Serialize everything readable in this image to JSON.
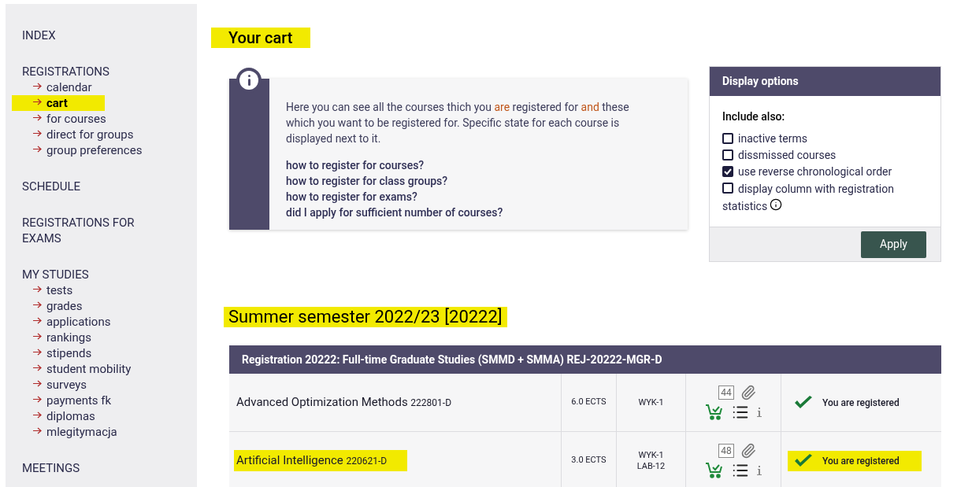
{
  "sidebar": {
    "sections": [
      {
        "title": "INDEX"
      },
      {
        "title": "REGISTRATIONS",
        "items": [
          {
            "label": "calendar",
            "selected": false
          },
          {
            "label": "cart",
            "selected": true
          },
          {
            "label": "for courses",
            "selected": false
          },
          {
            "label": "direct for groups",
            "selected": false
          },
          {
            "label": "group preferences",
            "selected": false
          }
        ]
      },
      {
        "title": "SCHEDULE"
      },
      {
        "title": "REGISTRATIONS FOR EXAMS"
      },
      {
        "title": "MY STUDIES",
        "items": [
          {
            "label": "tests",
            "selected": false
          },
          {
            "label": "grades",
            "selected": false
          },
          {
            "label": "applications",
            "selected": false
          },
          {
            "label": "rankings",
            "selected": false
          },
          {
            "label": "stipends",
            "selected": false
          },
          {
            "label": "student mobility",
            "selected": false
          },
          {
            "label": "surveys",
            "selected": false
          },
          {
            "label": "payments fk",
            "selected": false
          },
          {
            "label": "diplomas",
            "selected": false
          },
          {
            "label": "mlegitymacja",
            "selected": false
          }
        ]
      },
      {
        "title": "MEETINGS"
      }
    ]
  },
  "page_title": {
    "text": "Your cart",
    "highlighted": true
  },
  "info_box": {
    "text": [
      {
        "text": "Here you can see all the courses thich you ",
        "accent": false
      },
      {
        "text": "are",
        "accent": true
      },
      {
        "text": " registered for ",
        "accent": false
      },
      {
        "text": "and",
        "accent": true
      },
      {
        "text": " these which you want to be registered for. Specific state for each course is displayed next to it.",
        "accent": false
      }
    ],
    "links": [
      "how to register for courses?",
      "how to register for class groups?",
      "how to register for exams?",
      "did I apply for sufficient number of courses?"
    ]
  },
  "display_options": {
    "title": "Display options",
    "subtitle": "Include also:",
    "options": [
      {
        "label": "inactive terms",
        "checked": false
      },
      {
        "label": "dissmissed courses",
        "checked": false
      },
      {
        "label": "use reverse chronological order",
        "checked": true
      },
      {
        "label": "display column with registration statistics",
        "checked": false,
        "info": true
      }
    ],
    "apply": "Apply"
  },
  "semester": {
    "title": "Summer semester 2022/23 [20222]",
    "highlighted": true
  },
  "registration": {
    "title": "Registration 20222: Full-time Graduate Studies (SMMD + SMMA) REJ-20222-MGR-D",
    "rows": [
      {
        "name": "Advanced Optimization Methods",
        "code": "222801-D",
        "ects": "6.0 ECTS",
        "groups": [
          "WYK-1"
        ],
        "count": "44",
        "status": "You are registered",
        "highlighted": false
      },
      {
        "name": "Artificial Intelligence",
        "code": "220621-D",
        "ects": "3.0 ECTS",
        "groups": [
          "WYK-1",
          "LAB-12"
        ],
        "count": "48",
        "status": "You are registered",
        "highlighted": true
      }
    ]
  }
}
